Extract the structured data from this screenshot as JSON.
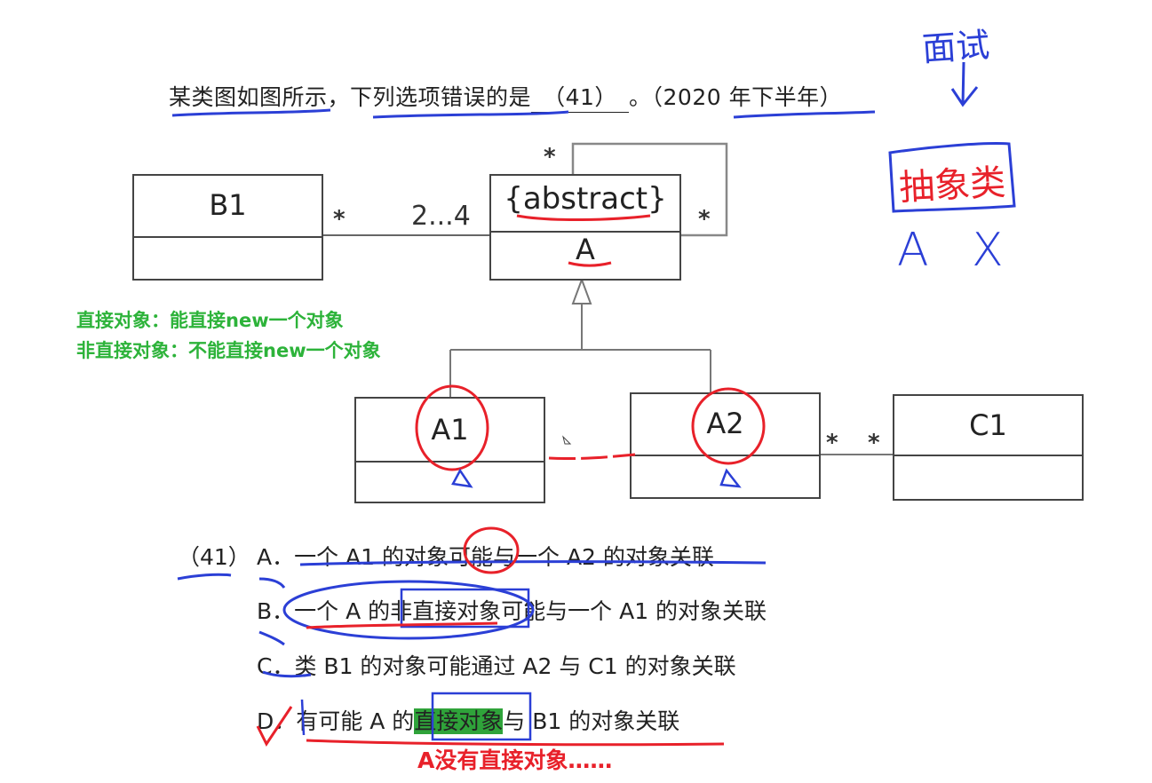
{
  "question": {
    "stem": "某类图如图所示，下列选项错误的是",
    "blank": "（41）",
    "tail": "。（2020 年下半年）"
  },
  "diagram": {
    "classes": {
      "b1": "B1",
      "a_stereotype": "{abstract}",
      "a": "A",
      "a1": "A1",
      "a2": "A2",
      "c1": "C1"
    },
    "multiplicities": {
      "b1_side": "*",
      "a_side": "2...4",
      "self_top": "*",
      "self_right": "*",
      "a2_c1_left": "*",
      "c1_left": "*"
    }
  },
  "notes": {
    "green_line1": "直接对象：能直接new一个对象",
    "green_line2": "非直接对象：不能直接new一个对象",
    "handwritten_top": "面试",
    "handwritten_box": "抽象类",
    "handwritten_a": "A",
    "handwritten_x": "X",
    "red_answer": "A没有直接对象……"
  },
  "options": {
    "number": "（41）",
    "a_letter": "A．",
    "a_text": "一个 A1 的对象可能与一个 A2 的对象关联",
    "b_letter": "B．",
    "b_text": "一个 A 的非直接对象可能与一个 A1 的对象关联",
    "c_letter": "C．",
    "c_text": "类 B1 的对象可能通过 A2 与 C1 的对象关联",
    "d_letter": "D．",
    "d_pre": "有可能 A 的",
    "d_highlight": "直接对象",
    "d_post": "与 B1 的对象关联"
  },
  "colors": {
    "annotation_blue": "#2b3fd6",
    "annotation_red": "#e8212a",
    "green_text": "#2db33a",
    "highlight_green": "#2fa33a"
  }
}
